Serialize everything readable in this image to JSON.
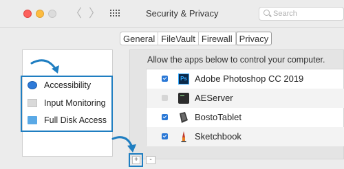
{
  "window": {
    "title": "Security & Privacy",
    "search_placeholder": "Search",
    "nav_back": "〈",
    "nav_forward": "〉"
  },
  "tabs": [
    {
      "label": "General",
      "active": false
    },
    {
      "label": "FileVault",
      "active": false
    },
    {
      "label": "Firewall",
      "active": false
    },
    {
      "label": "Privacy",
      "active": true
    }
  ],
  "sidebar": {
    "items": [
      {
        "label": "Accessibility",
        "icon": "accessibility-icon"
      },
      {
        "label": "Input Monitoring",
        "icon": "keyboard-icon"
      },
      {
        "label": "Full Disk Access",
        "icon": "folder-icon"
      }
    ]
  },
  "main": {
    "description": "Allow the apps below to control your computer.",
    "apps": [
      {
        "name": "Adobe Photoshop CC 2019",
        "checked": true,
        "icon": "photoshop-icon"
      },
      {
        "name": "AEServer",
        "checked": false,
        "icon": "terminal-icon"
      },
      {
        "name": "BostoTablet",
        "checked": true,
        "icon": "tablet-icon"
      },
      {
        "name": "Sketchbook",
        "checked": true,
        "icon": "sketchbook-icon"
      }
    ]
  },
  "controls": {
    "add_label": "+",
    "remove_label": "-"
  },
  "colors": {
    "highlight": "#1f7ec1",
    "checkbox": "#2a78d6"
  }
}
